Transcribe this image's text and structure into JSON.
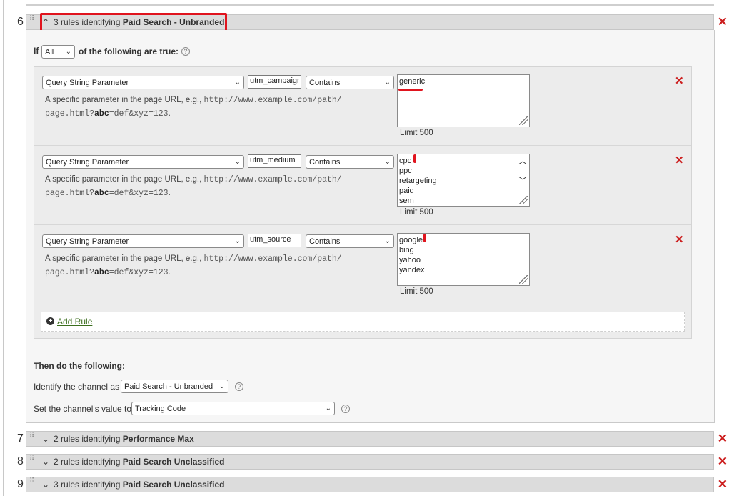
{
  "sections": [
    {
      "number": "6",
      "count_text": "3 rules identifying",
      "name": "Paid Search - Unbranded",
      "expanded": true
    },
    {
      "number": "7",
      "count_text": "2 rules identifying",
      "name": "Performance Max",
      "expanded": false
    },
    {
      "number": "8",
      "count_text": "2 rules identifying",
      "name": "Paid Search Unclassified",
      "expanded": false
    },
    {
      "number": "9",
      "count_text": "3 rules identifying",
      "name": "Paid Search Unclassified",
      "expanded": false
    }
  ],
  "condition": {
    "prefix": "If",
    "match_value": "All",
    "suffix": "of the following are true:"
  },
  "rules": [
    {
      "type": "Query String Parameter",
      "param": "utm_campaigr",
      "operator": "Contains",
      "values": [
        "generic"
      ],
      "limit": "Limit 500"
    },
    {
      "type": "Query String Parameter",
      "param": "utm_medium",
      "operator": "Contains",
      "values": [
        "cpc",
        "ppc",
        "retargeting",
        "paid",
        "sem"
      ],
      "limit": "Limit 500"
    },
    {
      "type": "Query String Parameter",
      "param": "utm_source",
      "operator": "Contains",
      "values": [
        "google",
        "bing",
        "yahoo",
        "yandex"
      ],
      "limit": "Limit 500"
    }
  ],
  "description": {
    "lead": "A specific parameter in the page URL, e.g.,",
    "url_a": "http://www.example.com/path/",
    "url_b": "page.html?",
    "url_bold": "abc",
    "url_c": "=def&xyz=123",
    "end": "."
  },
  "add_rule_label": "Add Rule",
  "then_label": "Then do the following:",
  "identify_label": "Identify the channel as",
  "identify_value": "Paid Search - Unbranded",
  "set_value_label": "Set the channel's value to",
  "set_value_value": "Tracking Code",
  "colors": {
    "delete": "#cc1e1e",
    "highlight": "#e0141e",
    "link": "#3b6e1d"
  }
}
